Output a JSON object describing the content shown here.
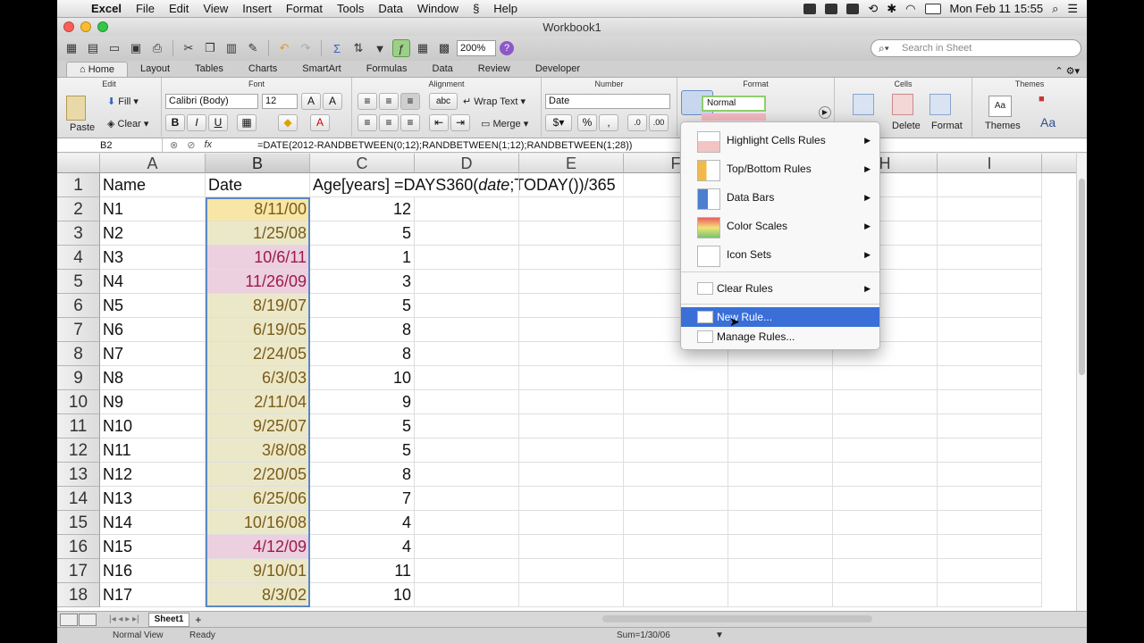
{
  "menubar": {
    "apple": "",
    "items": [
      "Excel",
      "File",
      "Edit",
      "View",
      "Insert",
      "Format",
      "Tools",
      "Data",
      "Window",
      "Help"
    ],
    "clock": "Mon Feb 11  15:55"
  },
  "window": {
    "title": "Workbook1"
  },
  "toolbar": {
    "zoom": "200%",
    "search_placeholder": "Search in Sheet"
  },
  "ribbon_tabs": [
    "Home",
    "Layout",
    "Tables",
    "Charts",
    "SmartArt",
    "Formulas",
    "Data",
    "Review",
    "Developer"
  ],
  "ribbon": {
    "edit_label": "Edit",
    "font_label": "Font",
    "alignment_label": "Alignment",
    "number_label": "Number",
    "format_label": "Format",
    "cells_label": "Cells",
    "themes_label": "Themes",
    "paste": "Paste",
    "fill": "Fill",
    "clear": "Clear",
    "font_name": "Calibri (Body)",
    "font_size": "12",
    "wrap_text": "Wrap Text",
    "merge": "Merge",
    "number_format": "Date",
    "style_normal": "Normal",
    "delete": "Delete",
    "format": "Format",
    "themes": "Themes"
  },
  "formula_bar": {
    "cell_ref": "B2",
    "formula": "=DATE(2012-RANDBETWEEN(0;12);RANDBETWEEN(1;12);RANDBETWEEN(1;28))"
  },
  "columns": [
    "A",
    "B",
    "C",
    "D",
    "E",
    "F",
    "H",
    "I"
  ],
  "header_row": {
    "a": "Name",
    "b": "Date",
    "c": "Age[years] =DAYS360(",
    "c_italic": "date",
    "c_tail": ";TODAY())/365"
  },
  "rows": [
    {
      "n": "2",
      "name": "N1",
      "date": "8/11/00",
      "age": "12"
    },
    {
      "n": "3",
      "name": "N2",
      "date": "1/25/08",
      "age": "5"
    },
    {
      "n": "4",
      "name": "N3",
      "date": "10/6/11",
      "age": "1"
    },
    {
      "n": "5",
      "name": "N4",
      "date": "11/26/09",
      "age": "3"
    },
    {
      "n": "6",
      "name": "N5",
      "date": "8/19/07",
      "age": "5"
    },
    {
      "n": "7",
      "name": "N6",
      "date": "6/19/05",
      "age": "8"
    },
    {
      "n": "8",
      "name": "N7",
      "date": "2/24/05",
      "age": "8"
    },
    {
      "n": "9",
      "name": "N8",
      "date": "6/3/03",
      "age": "10"
    },
    {
      "n": "10",
      "name": "N9",
      "date": "2/11/04",
      "age": "9"
    },
    {
      "n": "11",
      "name": "N10",
      "date": "9/25/07",
      "age": "5"
    },
    {
      "n": "12",
      "name": "N11",
      "date": "3/8/08",
      "age": "5"
    },
    {
      "n": "13",
      "name": "N12",
      "date": "2/20/05",
      "age": "8"
    },
    {
      "n": "14",
      "name": "N13",
      "date": "6/25/06",
      "age": "7"
    },
    {
      "n": "15",
      "name": "N14",
      "date": "10/16/08",
      "age": "4"
    },
    {
      "n": "16",
      "name": "N15",
      "date": "4/12/09",
      "age": "4"
    },
    {
      "n": "17",
      "name": "N16",
      "date": "9/10/01",
      "age": "11"
    },
    {
      "n": "18",
      "name": "N17",
      "date": "8/3/02",
      "age": "10"
    }
  ],
  "row1_label": "1",
  "cf_menu": {
    "items": [
      "Highlight Cells Rules",
      "Top/Bottom Rules",
      "Data Bars",
      "Color Scales",
      "Icon Sets",
      "Clear Rules",
      "New Rule...",
      "Manage Rules..."
    ],
    "highlighted": "New Rule..."
  },
  "sheet_tabs": {
    "active": "Sheet1",
    "add": "+"
  },
  "statusbar": {
    "view": "Normal View",
    "state": "Ready",
    "sum": "Sum=1/30/06"
  },
  "colors": {
    "selection": "#5c88c4",
    "menu_highlight": "#3a6fd8",
    "date_text": "#7a5b19",
    "date_pink_text": "#9c1a4b"
  }
}
